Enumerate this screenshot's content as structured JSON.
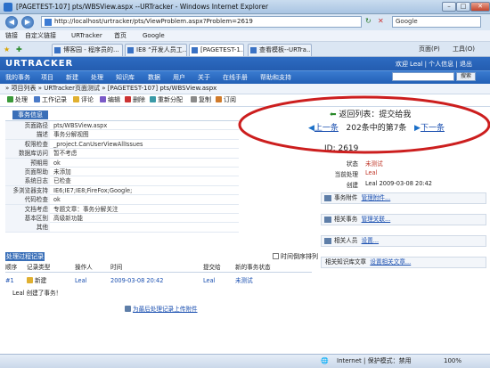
{
  "window": {
    "title": "[PAGETEST-107] pts/WBSView.aspx --URTracker - Windows Internet Explorer"
  },
  "browser": {
    "url": "http://localhost/urtracker/pts/ViewProblem.aspx?Problem=2619",
    "search_placeholder": "Google",
    "fav": {
      "links": "链接",
      "custom": "自定义链接",
      "urtracker": "URTracker",
      "home": "首页",
      "google": "Google"
    },
    "tabs": [
      "博客园 - 程序员的...",
      "IE8 “开发人员工...",
      "[PAGETEST-1...",
      "查看模板--URTra..."
    ],
    "tools": {
      "page": "页面(P)",
      "tools": "工具(O)"
    }
  },
  "app": {
    "logo": "URTRACKER",
    "welcome": "欢迎 Leal | 个人信息 | 退出",
    "search_button": "搜索",
    "menu": [
      "我的事务",
      "项目",
      "新建",
      "处理",
      "知识库",
      "数据",
      "用户",
      "关于",
      "在线手册",
      "帮助和支持"
    ]
  },
  "page": {
    "breadcrumb": "» 项目列表 » URTracker页面测试 » [PAGETEST-107] pts/WBSView.aspx",
    "actions": [
      "处理",
      "工作记录",
      "评论",
      "编辑",
      "删除",
      "重新分配",
      "复制",
      "订阅"
    ],
    "info_tab": "事务信息",
    "fields": [
      {
        "k": "页面路径",
        "v": "pts/WBSView.aspx"
      },
      {
        "k": "描述",
        "v": "事务分解视图"
      },
      {
        "k": "权限检查",
        "v": "_project.CanUserViewAllIssues"
      },
      {
        "k": "数据库访问",
        "v": "暂不考虑"
      },
      {
        "k": "预期用",
        "v": "ok"
      },
      {
        "k": "页面帮助",
        "v": "未添加"
      },
      {
        "k": "系统日志",
        "v": "已检查"
      },
      {
        "k": "多浏览器支持",
        "v": "IE6;IE7;IE8;FireFox;Google;"
      },
      {
        "k": "代码检查",
        "v": "ok"
      },
      {
        "k": "文档考虑",
        "v": "专题文章：事务分解关注"
      },
      {
        "k": "基本区别",
        "v": "高级新功能"
      },
      {
        "k": "其他",
        "v": ""
      }
    ],
    "process_tab": "处理过程记录",
    "time_order": "时间倒序排列",
    "history_headers": [
      "顺序",
      "记录类型",
      "操作人",
      "时间",
      "提交给",
      "新的事务状态"
    ],
    "history_row": {
      "seq": "#1",
      "type": "新建",
      "user": "Leal",
      "time": "2009-03-08 20:42",
      "to": "Leal",
      "status": "未测试"
    },
    "history_note": "Leal 创建了事务！",
    "attach_link": "为最后处理记录上传附件",
    "issue_id": "ID: 2619",
    "status_label": "状态",
    "status_value": "未测试",
    "handler_label": "当前处理",
    "handler_value": "Leal",
    "created_label": "创建",
    "created_value": "Leal  2009-03-08 20:42",
    "attachments_label": "事务附件",
    "attachments_link": "管理附件...",
    "related_label": "相关事务",
    "related_link": "管理关联...",
    "people_label": "相关人员",
    "people_link": "设置...",
    "kb_label": "相关知识库文章",
    "kb_link": "设置相关文章...",
    "back_to_list": "返回列表：提交给我",
    "prev": "上一条",
    "position": "202条中的第7条",
    "next": "下一条"
  },
  "statusbar": {
    "protected": "Internet | 保护模式：禁用",
    "zoom": "100%"
  },
  "colors": {
    "accent": "#225fb5",
    "highlight_oval": "#cc1e1e",
    "link": "#1a4fb0",
    "status_red": "#c0392b"
  }
}
